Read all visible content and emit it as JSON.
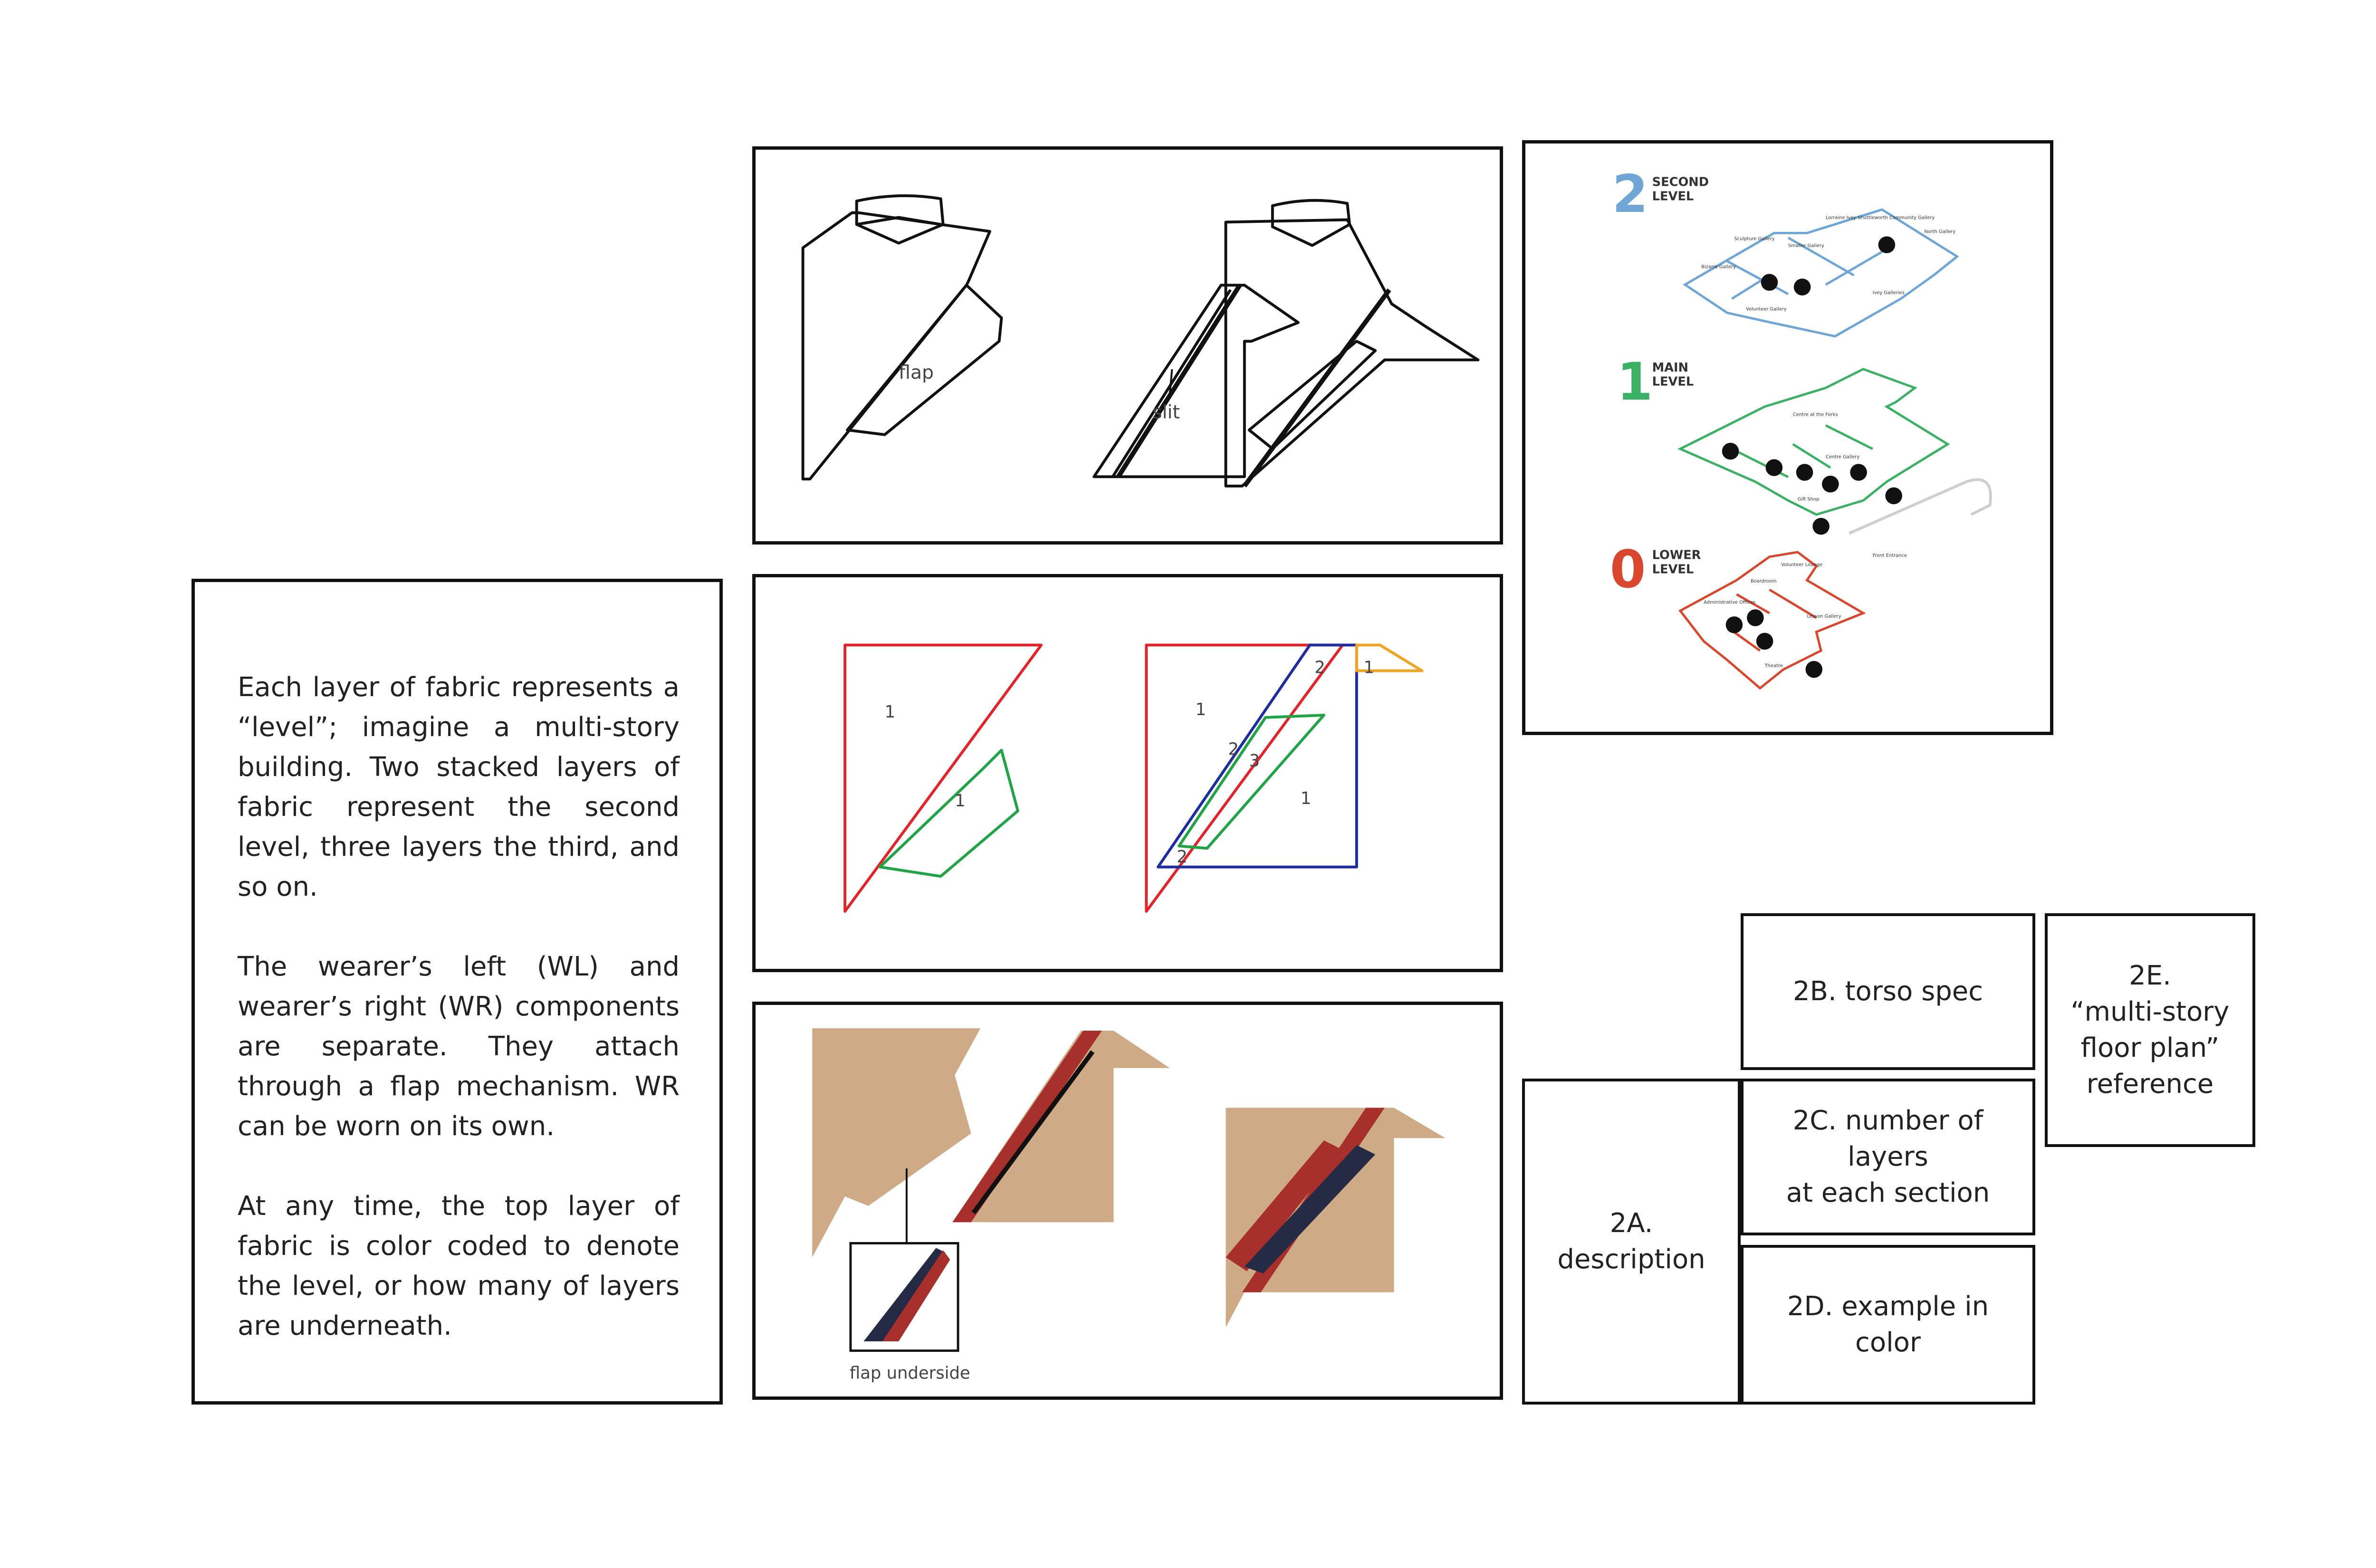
{
  "description": {
    "paragraph_1": "Each layer of fabric represents a “level”; imagine a multi-story building. Two stacked layers of fabric represent the second level, three layers the third, and so on.",
    "paragraph_2": "The wearer’s left (WL) and wearer’s right (WR) components are separate. They attach through a flap mechanism. WR can be worn on its own.",
    "paragraph_3": "At any time, the top layer of fabric is color coded to denote the level, or how many of layers are underneath."
  },
  "torso_spec": {
    "flap_label": "flap",
    "slit_label": "slit"
  },
  "layers_diagram": {
    "left_labels": [
      "1",
      "1"
    ],
    "right_labels": [
      "1",
      "2",
      "1",
      "2",
      "3",
      "1",
      "2"
    ]
  },
  "color_example": {
    "flap_underside_label": "flap underside"
  },
  "floor_plan": {
    "levels": [
      {
        "number": "2",
        "name_line1": "SECOND",
        "name_line2": "LEVEL",
        "color": "#6fa6d6"
      },
      {
        "number": "1",
        "name_line1": "MAIN",
        "name_line2": "LEVEL",
        "color": "#3cb064"
      },
      {
        "number": "0",
        "name_line1": "LOWER",
        "name_line2": "LEVEL",
        "color": "#d9472f"
      }
    ],
    "rooms_level2": [
      "Lorraine Ivey Shuttleworth Community Gallery",
      "Sculpture Gallery",
      "Bizarre Gallery",
      "Smaller Gallery",
      "North Gallery",
      "Volunteer Gallery",
      "Ivey Galleries"
    ],
    "rooms_level1": [
      "Centre at the Forks",
      "Centre Gallery",
      "Gift Shop",
      "Front Entrance"
    ],
    "rooms_level0": [
      "Volunteer Lounge",
      "Boardroom",
      "Administrative Offices",
      "Lesson Gallery",
      "Theatre"
    ]
  },
  "legend": {
    "box_2a_line1": "2A.",
    "box_2a_line2": "description",
    "box_2b": "2B. torso spec",
    "box_2c_line1": "2C. number of layers",
    "box_2c_line2": "at each section",
    "box_2d": "2D. example in color",
    "box_2e_line1": "2E.",
    "box_2e_line2": "“multi-story",
    "box_2e_line3": "floor plan”",
    "box_2e_line4": "reference"
  },
  "colors": {
    "fabric_tan": "#cfaa87",
    "level_red": "#a8302c",
    "level_navy": "#252a45",
    "outline_red": "#e0262b",
    "outline_green": "#23a347",
    "outline_blue": "#1f2e9c",
    "outline_orange": "#f0a526"
  }
}
